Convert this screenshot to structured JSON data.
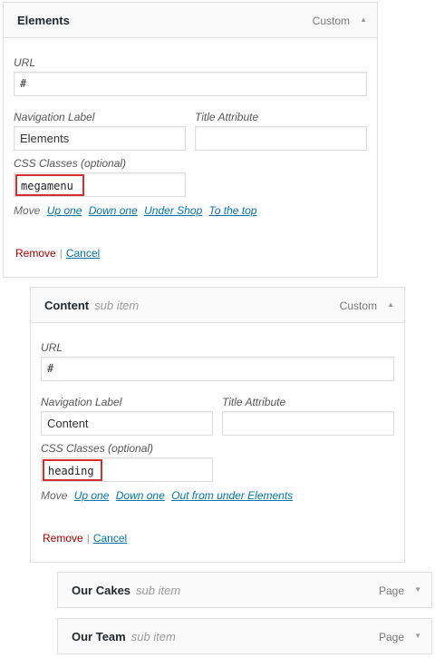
{
  "items": [
    {
      "title": "Elements",
      "subitem": "",
      "type": "Custom",
      "url_label": "URL",
      "url_value": "#",
      "nav_label_label": "Navigation Label",
      "nav_label_value": "Elements",
      "title_attr_label": "Title Attribute",
      "title_attr_value": "",
      "css_label": "CSS Classes (optional)",
      "css_value": "megamenu",
      "move_label": "Move",
      "move_links": [
        "Up one",
        "Down one",
        "Under Shop",
        "To the top"
      ],
      "remove_label": "Remove",
      "separator": "|",
      "cancel_label": "Cancel"
    },
    {
      "title": "Content",
      "subitem": "sub item",
      "type": "Custom",
      "url_label": "URL",
      "url_value": "#",
      "nav_label_label": "Navigation Label",
      "nav_label_value": "Content",
      "title_attr_label": "Title Attribute",
      "title_attr_value": "",
      "css_label": "CSS Classes (optional)",
      "css_value": "heading",
      "move_label": "Move",
      "move_links": [
        "Up one",
        "Down one",
        "Out from under Elements"
      ],
      "remove_label": "Remove",
      "separator": "|",
      "cancel_label": "Cancel"
    },
    {
      "title": "Our Cakes",
      "subitem": "sub item",
      "type": "Page"
    },
    {
      "title": "Our Team",
      "subitem": "sub item",
      "type": "Page"
    }
  ],
  "icons": {
    "expanded": "triangle-up",
    "collapsed": "triangle-down"
  },
  "colors": {
    "highlight_border": "#d62f2f",
    "link": "#0073aa",
    "remove": "#aa0000"
  }
}
